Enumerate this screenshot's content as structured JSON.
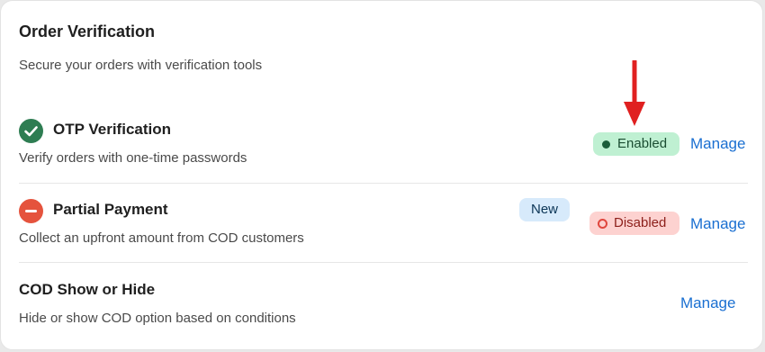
{
  "card": {
    "title": "Order Verification",
    "subtitle": "Secure your orders with verification tools"
  },
  "rows": [
    {
      "icon": "check-circle-icon",
      "title": "OTP Verification",
      "description": "Verify orders with one-time passwords",
      "status": "Enabled",
      "status_color": "#bff0d2",
      "action": "Manage"
    },
    {
      "icon": "minus-circle-icon",
      "title": "Partial Payment",
      "description": "Collect an upfront amount from COD customers",
      "tag": "New",
      "status": "Disabled",
      "status_color": "#fdd2d0",
      "action": "Manage"
    },
    {
      "title": "COD Show or Hide",
      "description": "Hide or show COD option based on conditions",
      "action": "Manage"
    }
  ],
  "colors": {
    "accent_link": "#1a6fd1",
    "success": "#2e7d52",
    "danger": "#e5533d",
    "annotation_arrow": "#e02020"
  }
}
